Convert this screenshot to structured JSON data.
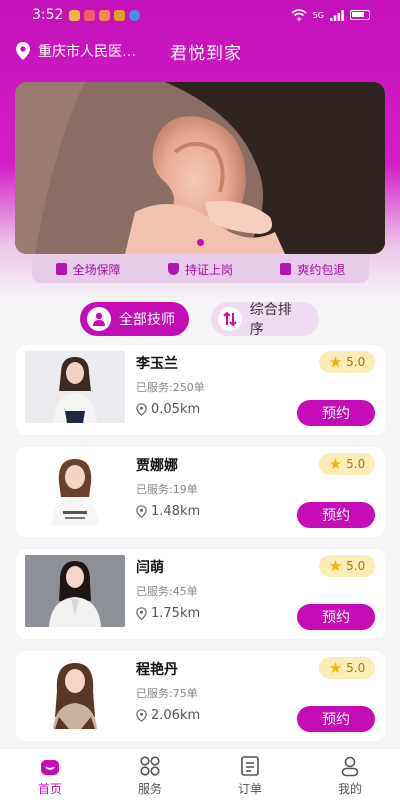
{
  "status_bar": {
    "time": "3:52",
    "signal": "5G"
  },
  "header": {
    "location": "重庆市人民医…",
    "title": "君悦到家"
  },
  "guarantees": [
    {
      "label": "全场保障",
      "icon": "badge-icon"
    },
    {
      "label": "持证上岗",
      "icon": "shield-icon"
    },
    {
      "label": "爽约包退",
      "icon": "refund-icon"
    }
  ],
  "tabs": [
    {
      "label": "全部技师",
      "icon": "person-icon"
    },
    {
      "label": "综合排序",
      "icon": "sort-icon"
    }
  ],
  "technicians": [
    {
      "name": "李玉兰",
      "served": "已服务:250单",
      "distance": "0.05km",
      "rating": "5.0",
      "book_label": "预约"
    },
    {
      "name": "贾娜娜",
      "served": "已服务:19单",
      "distance": "1.48km",
      "rating": "5.0",
      "book_label": "预约"
    },
    {
      "name": "闫萌",
      "served": "已服务:45单",
      "distance": "1.75km",
      "rating": "5.0",
      "book_label": "预约"
    },
    {
      "name": "程艳丹",
      "served": "已服务:75单",
      "distance": "2.06km",
      "rating": "5.0",
      "book_label": "预约"
    }
  ],
  "bottom_nav": [
    {
      "label": "首页",
      "icon": "home-icon"
    },
    {
      "label": "服务",
      "icon": "grid-icon"
    },
    {
      "label": "订单",
      "icon": "order-icon"
    },
    {
      "label": "我的",
      "icon": "profile-icon"
    }
  ],
  "colors": {
    "brand": "#c40cb7",
    "rating_bg": "#fbedb8"
  }
}
